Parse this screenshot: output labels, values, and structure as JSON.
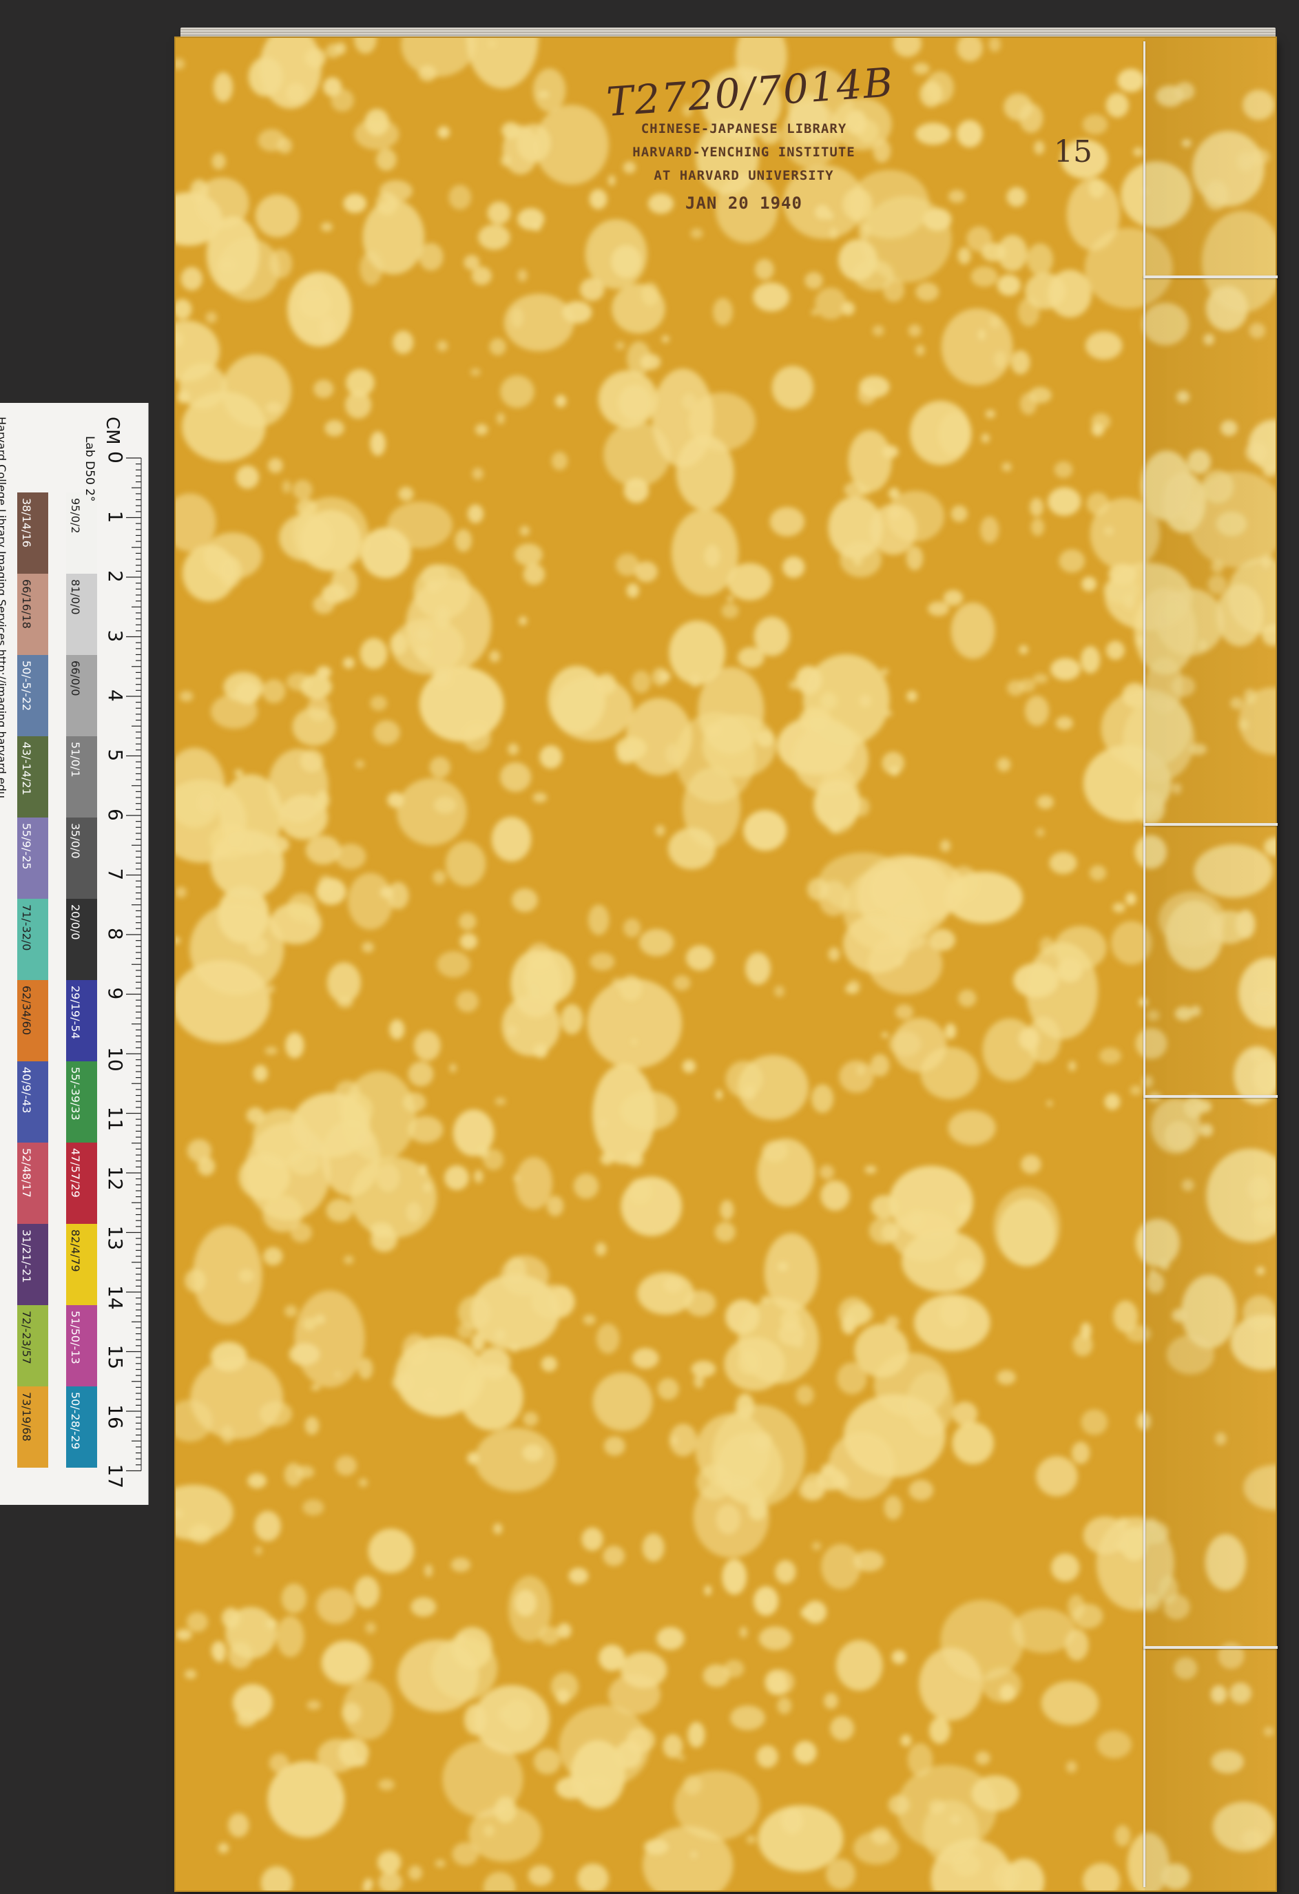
{
  "cover": {
    "color": "#d9a12a",
    "spot_color": "#f3dc8f",
    "stamp_lines": [
      "CHINESE-JAPANESE LIBRARY",
      "HARVARD-YENCHING INSTITUTE",
      "AT HARVARD UNIVERSITY"
    ],
    "stamp_date": "JAN 20 1940",
    "call_number": "T2720/7014B",
    "volume_number": "15"
  },
  "color_target": {
    "unit_label": "CM",
    "lab_label": "Lab D50 2°",
    "credit": "Harvard College Library Imaging Services http://imaging.harvard.edu",
    "ruler_numbers": [
      "0",
      "1",
      "2",
      "3",
      "4",
      "5",
      "6",
      "7",
      "8",
      "9",
      "10",
      "11",
      "12",
      "13",
      "14",
      "15",
      "16",
      "17"
    ],
    "gray_patches": [
      {
        "label": "95/0/2",
        "color": "#f2f2ef"
      },
      {
        "label": "81/0/0",
        "color": "#cfcfcf"
      },
      {
        "label": "66/0/0",
        "color": "#a6a6a6"
      },
      {
        "label": "51/0/1",
        "color": "#7f7f7f"
      },
      {
        "label": "35/0/0",
        "color": "#575757"
      },
      {
        "label": "20/0/0",
        "color": "#333333"
      },
      {
        "label": "29/19/-54",
        "color": "#3a3f9c"
      },
      {
        "label": "55/-39/33",
        "color": "#3d9149"
      },
      {
        "label": "47/57/29",
        "color": "#b92b3c"
      },
      {
        "label": "82/4/79",
        "color": "#e9c81e"
      },
      {
        "label": "51/50/-13",
        "color": "#b54a94"
      },
      {
        "label": "50/-28/-29",
        "color": "#1e86ab"
      }
    ],
    "color_patches": [
      {
        "label": "38/14/16",
        "color": "#765446"
      },
      {
        "label": "66/16/18",
        "color": "#c39482"
      },
      {
        "label": "50/-5/-22",
        "color": "#627ea6"
      },
      {
        "label": "43/-14/21",
        "color": "#5a6e40"
      },
      {
        "label": "55/9/-25",
        "color": "#8179b0"
      },
      {
        "label": "71/-32/0",
        "color": "#5bbba8"
      },
      {
        "label": "62/34/60",
        "color": "#d8792a"
      },
      {
        "label": "40/9/-43",
        "color": "#4957a6"
      },
      {
        "label": "52/48/17",
        "color": "#c35262"
      },
      {
        "label": "31/21/-21",
        "color": "#5c3c73"
      },
      {
        "label": "72/-23/57",
        "color": "#99b844"
      },
      {
        "label": "73/19/68",
        "color": "#e0a02e"
      }
    ]
  }
}
